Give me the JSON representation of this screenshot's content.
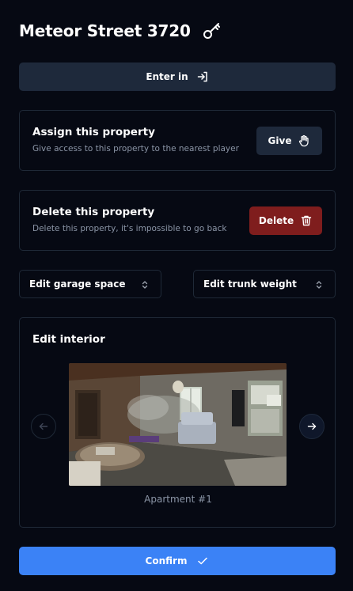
{
  "header": {
    "title": "Meteor Street 3720",
    "icon": "key-icon"
  },
  "enter": {
    "label": "Enter in",
    "icon": "sign-in-icon"
  },
  "assign": {
    "title": "Assign this property",
    "description": "Give access to this property to the nearest player",
    "button_label": "Give",
    "button_icon": "hand-icon"
  },
  "delete": {
    "title": "Delete this property",
    "description": "Delete this property, it's impossible to go back",
    "button_label": "Delete",
    "button_icon": "trash-icon"
  },
  "selects": {
    "garage_label": "Edit garage space",
    "trunk_label": "Edit trunk weight"
  },
  "interior": {
    "title": "Edit interior",
    "caption": "Apartment #1"
  },
  "confirm": {
    "label": "Confirm",
    "icon": "check-icon"
  },
  "colors": {
    "background": "#060913",
    "surface": "#1e293b",
    "border": "#1f2937",
    "danger": "#7f1d1d",
    "primary": "#3b82f6",
    "muted_text": "#8b95a6"
  }
}
